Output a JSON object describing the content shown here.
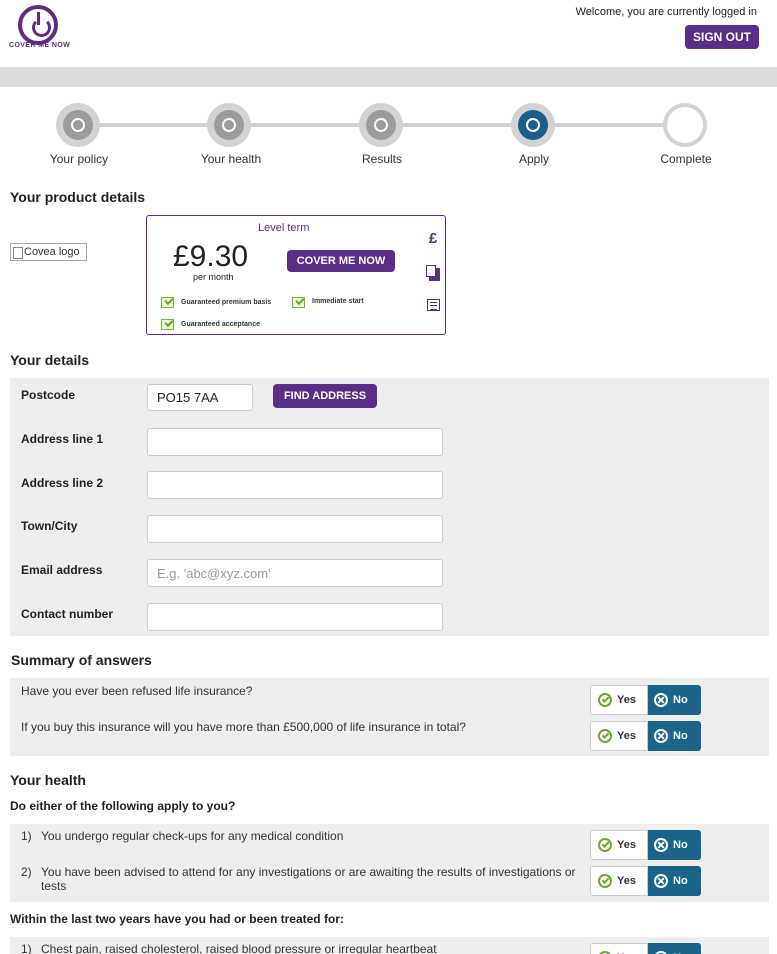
{
  "header": {
    "logo_text": "COVER ME NOW",
    "welcome": "Welcome, you are currently logged in",
    "signout_label": "SIGN OUT"
  },
  "progress": {
    "steps": [
      {
        "label": "Your policy",
        "state": "done"
      },
      {
        "label": "Your health",
        "state": "done"
      },
      {
        "label": "Results",
        "state": "done"
      },
      {
        "label": "Apply",
        "state": "current"
      },
      {
        "label": "Complete",
        "state": "pending"
      }
    ]
  },
  "product": {
    "heading": "Your product details",
    "logo_alt": "Covea logo",
    "level_term": "Level term",
    "price": "£9.30",
    "per_month": "per month",
    "cover_label": "COVER ME NOW",
    "features": [
      "Guaranteed premium basis",
      "Immediate start",
      "Guaranteed acceptance"
    ],
    "pound_icon": "£"
  },
  "details": {
    "heading": "Your details",
    "postcode_label": "Postcode",
    "postcode_value": "PO15 7AA",
    "find_address_label": "FIND ADDRESS",
    "address1_label": "Address line 1",
    "address2_label": "Address line 2",
    "town_label": "Town/City",
    "email_label": "Email address",
    "email_placeholder": "E.g. 'abc@xyz.com'",
    "contact_label": "Contact number"
  },
  "summary": {
    "heading": "Summary of answers",
    "questions": [
      "Have you ever been refused life insurance?",
      "If you buy this insurance will you have more than £500,000 of life insurance in total?"
    ]
  },
  "yes_label": "Yes",
  "no_label": "No",
  "health": {
    "heading": "Your health",
    "subheading1": "Do either of the following apply to you?",
    "items1": [
      {
        "num": "1)",
        "text": "You undergo regular check-ups for any medical condition"
      },
      {
        "num": "2)",
        "text": "You have been advised to attend for any investigations or are awaiting the results of investigations or tests"
      }
    ],
    "subheading2": "Within the last two years have you had or been treated for:",
    "items2": [
      {
        "num": "1)",
        "text": "Chest pain, raised cholesterol, raised blood pressure or irregular heartbeat"
      }
    ]
  }
}
